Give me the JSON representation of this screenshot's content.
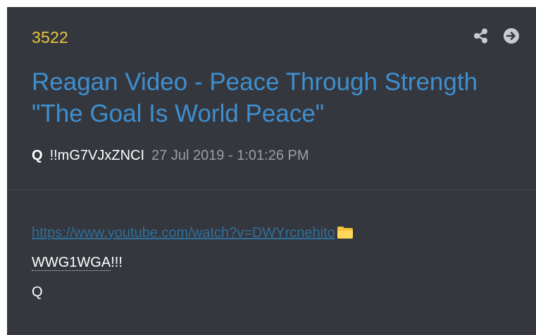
{
  "post": {
    "number": "3522",
    "title": "Reagan Video - Peace Through Strength \"The Goal Is World Peace\"",
    "author": "Q",
    "tripcode": "!!mG7VJxZNCI",
    "datetime": "27 Jul 2019 - 1:01:26 PM",
    "link": "https://www.youtube.com/watch?v=DWYrcnehito",
    "tag_text": "WWG1WGA",
    "tag_suffix": "!!!",
    "signature": "Q"
  },
  "icons": {
    "share": "share-icon",
    "goto": "arrow-circle-right-icon",
    "folder": "folder-icon"
  },
  "colors": {
    "background": "#35373e",
    "number": "#e7c83f",
    "title": "#3e8fcf",
    "link": "#2f6f9a",
    "meta": "#9c9ea6"
  }
}
